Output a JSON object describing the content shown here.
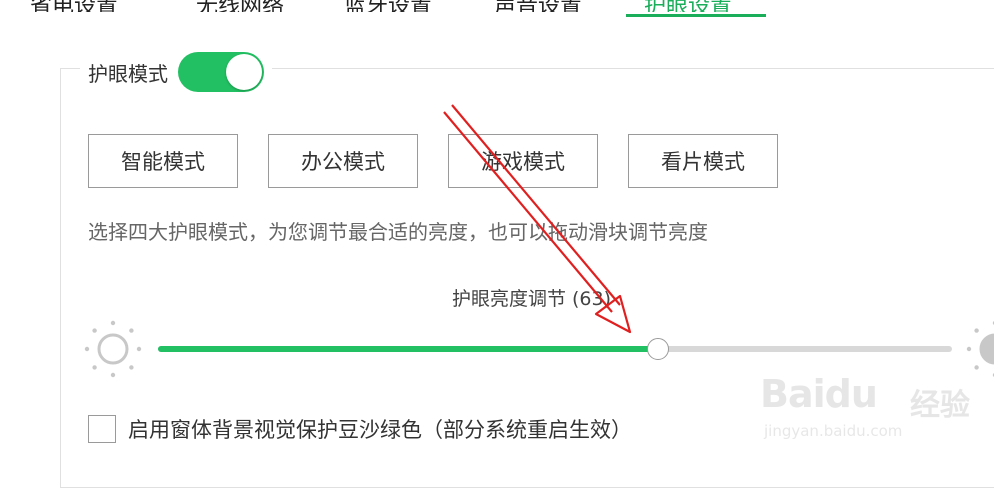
{
  "top_tabs": [
    {
      "label": "省电设置"
    },
    {
      "label": "无线网络"
    },
    {
      "label": "蓝牙设置"
    },
    {
      "label": "声音设置"
    },
    {
      "label": "护眼设置"
    }
  ],
  "eye_care": {
    "section_title": "护眼模式",
    "toggle_on": true,
    "modes": [
      "智能模式",
      "办公模式",
      "游戏模式",
      "看片模式"
    ],
    "description": "选择四大护眼模式，为您调节最合适的亮度，也可以拖动滑块调节亮度",
    "brightness_label": "护眼亮度调节",
    "brightness_value_text": "(63)",
    "brightness_value": 63,
    "brightness_max": 100,
    "checkbox_label": "启用窗体背景视觉保护豆沙绿色（部分系统重启生效）",
    "checkbox_checked": false
  },
  "colors": {
    "accent": "#22c062",
    "annotation_arrow": "#e02020"
  },
  "watermark": {
    "brand": "Baidu",
    "brand_cn": "经验",
    "url": "jingyan.baidu.com"
  }
}
